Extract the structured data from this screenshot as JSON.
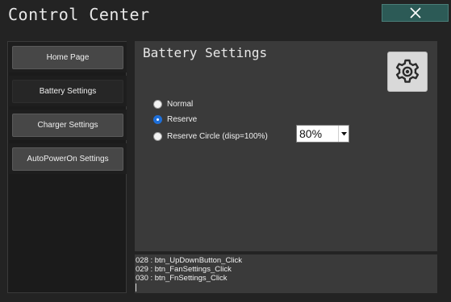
{
  "app": {
    "title": "Control Center"
  },
  "sidebar": {
    "items": [
      {
        "label": "Home Page",
        "active": false
      },
      {
        "label": "Battery Settings",
        "active": true
      },
      {
        "label": "Charger Settings",
        "active": false
      },
      {
        "label": "AutoPowerOn Settings",
        "active": false
      }
    ]
  },
  "panel": {
    "title": "Battery Settings",
    "options": [
      {
        "label": "Normal",
        "checked": false
      },
      {
        "label": "Reserve",
        "checked": true
      },
      {
        "label": "Reserve Circle (disp=100%)",
        "checked": false
      }
    ],
    "circle_select": {
      "value": "80%"
    }
  },
  "log": {
    "lines": [
      "028 : btn_UpDownButton_Click",
      "029 : btn_FanSettings_Click",
      "030 : btn_FnSettings_Click"
    ]
  },
  "colors": {
    "background": "#232323",
    "panel": "#3a3a3a",
    "close_button": "#2c5a56",
    "radio_checked": "#1e6fd9"
  },
  "icons": {
    "close": "close-icon",
    "settings": "gear-icon",
    "dropdown": "chevron-down-icon"
  }
}
